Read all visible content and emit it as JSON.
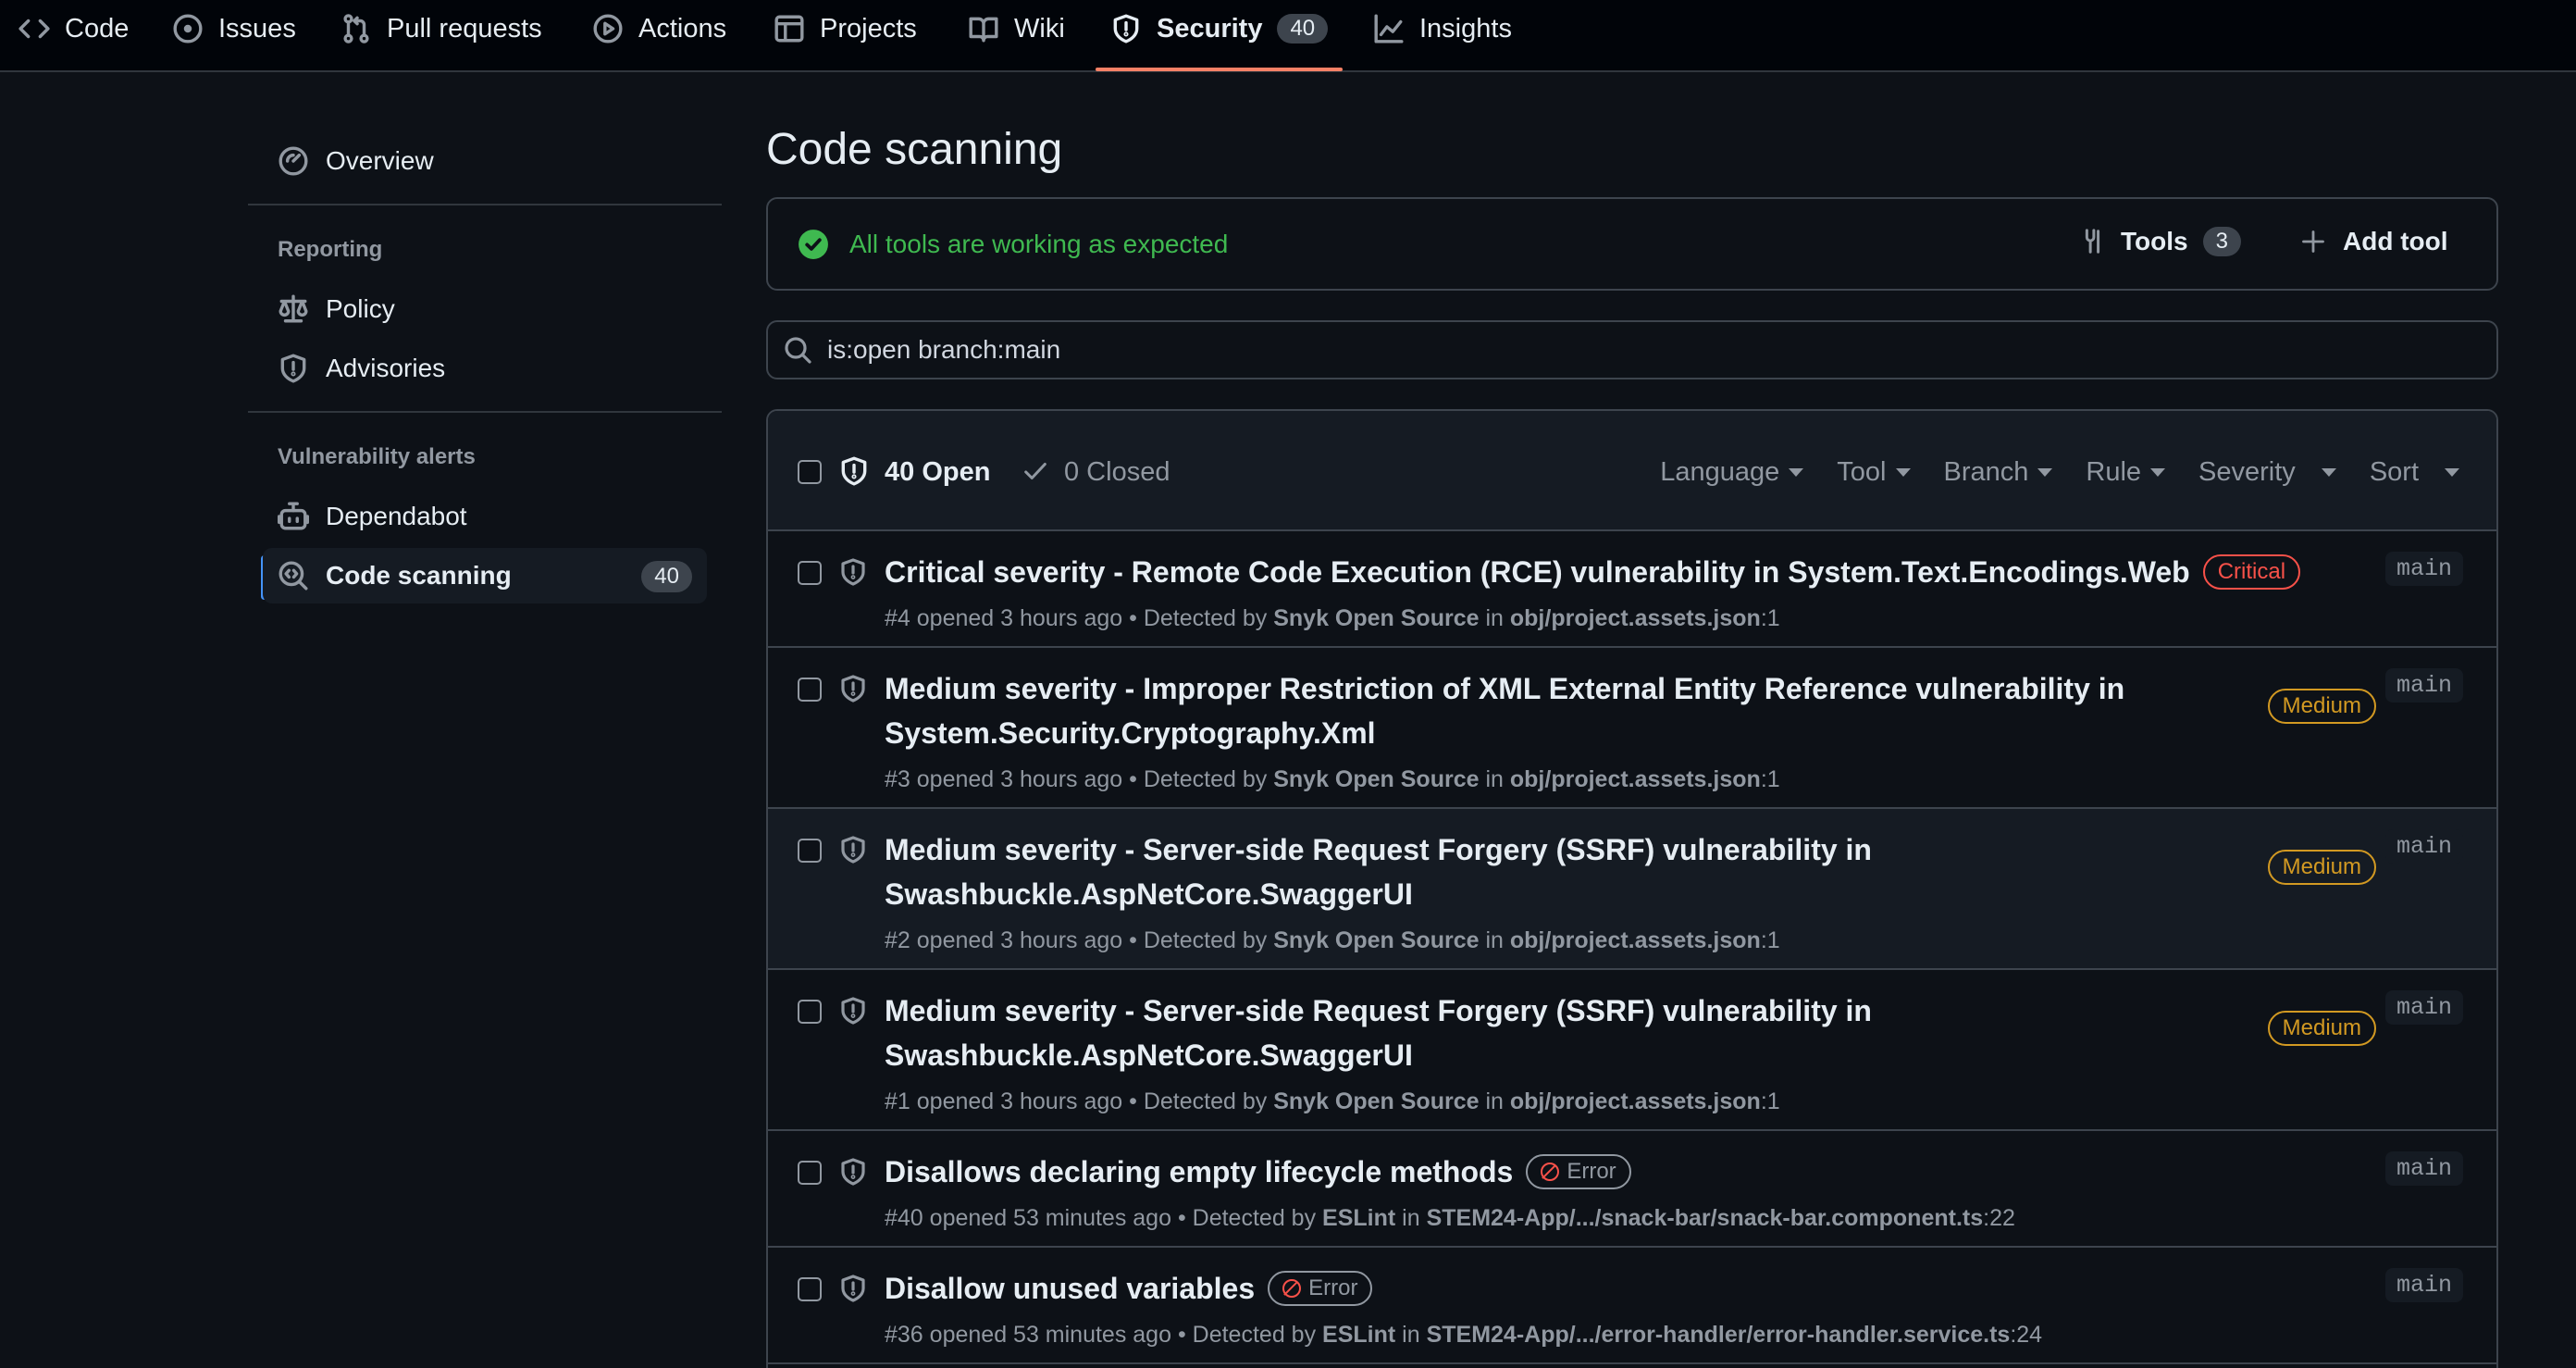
{
  "nav": {
    "tabs": [
      {
        "label": "Code",
        "icon": "code-icon"
      },
      {
        "label": "Issues",
        "icon": "issue-icon"
      },
      {
        "label": "Pull requests",
        "icon": "pull-request-icon"
      },
      {
        "label": "Actions",
        "icon": "play-icon"
      },
      {
        "label": "Projects",
        "icon": "table-icon"
      },
      {
        "label": "Wiki",
        "icon": "book-icon"
      },
      {
        "label": "Security",
        "icon": "shield-icon",
        "count": "40",
        "active": true
      },
      {
        "label": "Insights",
        "icon": "graph-icon"
      }
    ]
  },
  "sidebar": {
    "overview": "Overview",
    "reporting_heading": "Reporting",
    "policy": "Policy",
    "advisories": "Advisories",
    "vuln_heading": "Vulnerability alerts",
    "dependabot": "Dependabot",
    "code_scanning": "Code scanning",
    "code_scanning_count": "40"
  },
  "main": {
    "title": "Code scanning",
    "status_text": "All tools are working as expected",
    "tools_label": "Tools",
    "tools_count": "3",
    "add_tool": "Add tool",
    "search_value": "is:open branch:main",
    "open_label": "40 Open",
    "closed_label": "0 Closed",
    "filters": [
      "Language",
      "Tool",
      "Branch",
      "Rule",
      "Severity",
      "Sort"
    ]
  },
  "alerts": [
    {
      "title": "Critical severity - Remote Code Execution (RCE) vulnerability in System.Text.Encodings.Web",
      "label": "Critical",
      "number": "#4",
      "opened": "opened 3 hours ago",
      "detected_by": "Snyk Open Source",
      "file": "obj/project.assets.json",
      "line": ":1",
      "branch": "main"
    },
    {
      "title_l1": "Medium severity - Improper Restriction of XML External Entity Reference vulnerability in",
      "title_l2": "System.Security.Cryptography.Xml",
      "label": "Medium",
      "number": "#3",
      "opened": "opened 3 hours ago",
      "detected_by": "Snyk Open Source",
      "file": "obj/project.assets.json",
      "line": ":1",
      "branch": "main"
    },
    {
      "title_l1": "Medium severity - Server-side Request Forgery (SSRF) vulnerability in",
      "title_l2": "Swashbuckle.AspNetCore.SwaggerUI",
      "label": "Medium",
      "number": "#2",
      "opened": "opened 3 hours ago",
      "detected_by": "Snyk Open Source",
      "file": "obj/project.assets.json",
      "line": ":1",
      "branch": "main"
    },
    {
      "title_l1": "Medium severity - Server-side Request Forgery (SSRF) vulnerability in",
      "title_l2": "Swashbuckle.AspNetCore.SwaggerUI",
      "label": "Medium",
      "number": "#1",
      "opened": "opened 3 hours ago",
      "detected_by": "Snyk Open Source",
      "file": "obj/project.assets.json",
      "line": ":1",
      "branch": "main"
    },
    {
      "title": "Disallows declaring empty lifecycle methods",
      "label": "Error",
      "number": "#40",
      "opened": "opened 53 minutes ago",
      "detected_by": "ESLint",
      "file": "STEM24-App/.../snack-bar/snack-bar.component.ts",
      "line": ":22",
      "branch": "main"
    },
    {
      "title": "Disallow unused variables",
      "label": "Error",
      "number": "#36",
      "opened": "opened 53 minutes ago",
      "detected_by": "ESLint",
      "file": "STEM24-App/.../error-handler/error-handler.service.ts",
      "line": ":24",
      "branch": "main"
    }
  ],
  "meta_words": {
    "sep": " • ",
    "detected": "Detected by",
    "in": "in"
  },
  "colors": {
    "critical": "#f85149",
    "medium": "#d29922",
    "success": "#3fb950",
    "accent": "#4493f8",
    "tab_underline": "#f78166"
  }
}
